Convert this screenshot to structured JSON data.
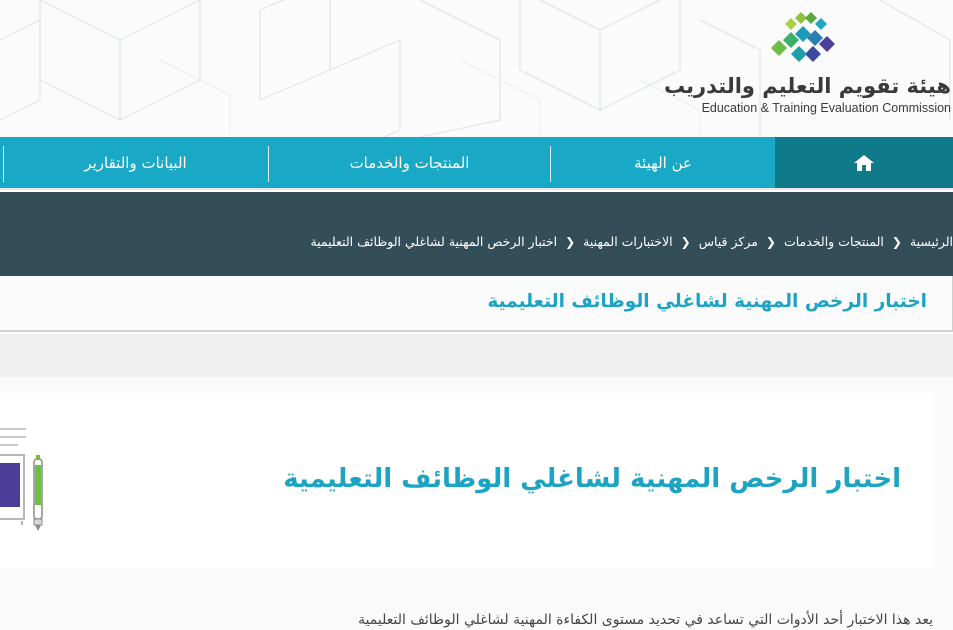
{
  "header": {
    "logo_ar": "هيئة تقويم التعليم والتدريب",
    "logo_en": "Education & Training Evaluation Commission"
  },
  "nav": {
    "home_icon": "home-icon",
    "items": [
      {
        "label": "عن الهيئة"
      },
      {
        "label": "المنتجات والخدمات"
      },
      {
        "label": "البيانات والتقارير"
      }
    ]
  },
  "breadcrumb": {
    "items": [
      "الرئيسية",
      "المنتجات والخدمات",
      "مركز قياس",
      "الاختبارات المهنية",
      "اختبار الرخص المهنية لشاغلي الوظائف التعليمية"
    ]
  },
  "page_title": "اختبار الرخص المهنية لشاغلي الوظائف التعليمية",
  "hero": {
    "title": "اختبار الرخص المهنية لشاغلي الوظائف التعليمية"
  },
  "intro_text": "يعد هذا الاختبار أحد الأدوات التي تساعد في تحديد مستوى الكفاءة المهنية لشاغلي الوظائف التعليمية",
  "colors": {
    "nav": "#19a9c6",
    "nav_home": "#0f7b8a",
    "breadcrumb_bar": "#334e59",
    "title": "#1ba4c3"
  }
}
